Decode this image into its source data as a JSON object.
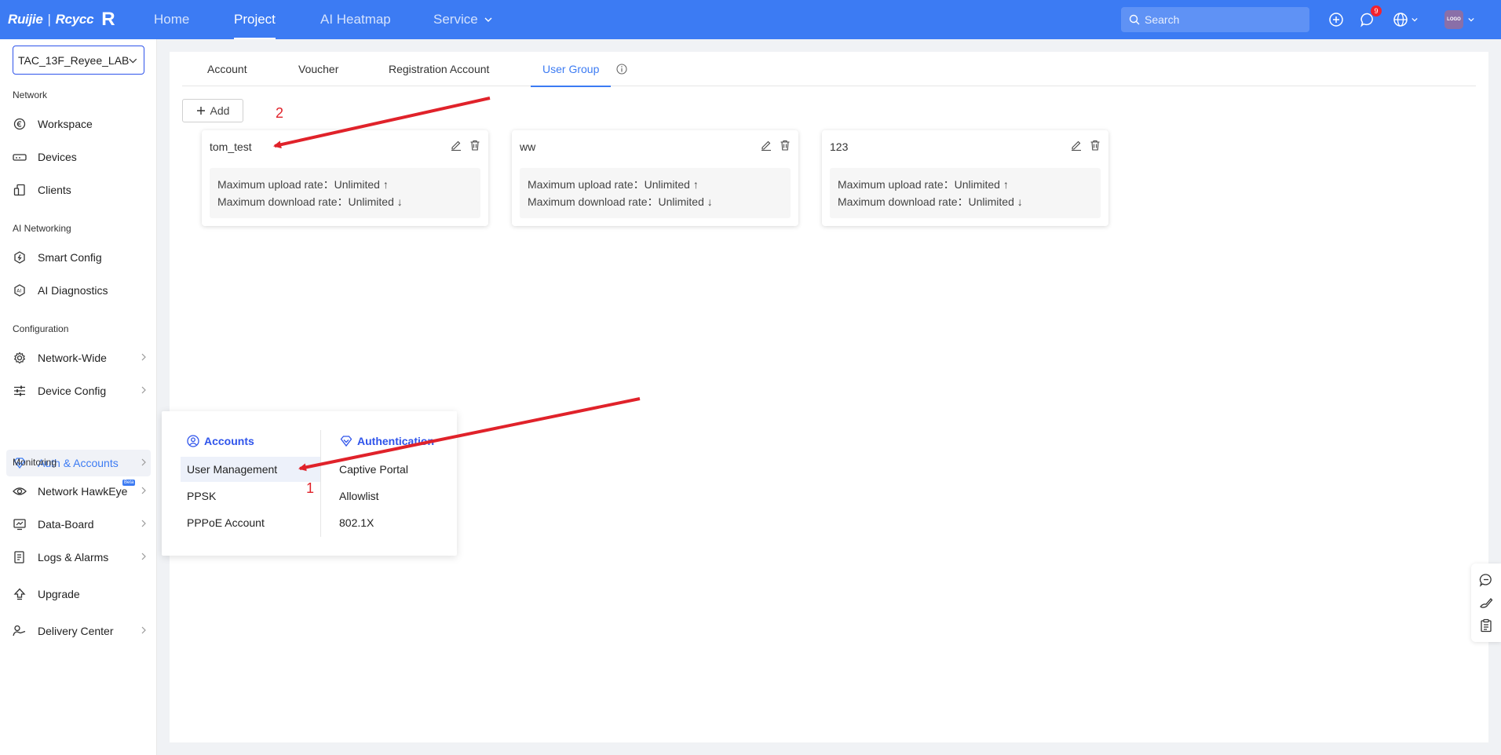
{
  "topbar": {
    "logo_brand": "Ruijie",
    "logo_sep": "|",
    "logo_sub": "Rcycc",
    "nav": [
      {
        "label": "Home"
      },
      {
        "label": "Project"
      },
      {
        "label": "AI Heatmap"
      },
      {
        "label": "Service"
      }
    ],
    "search_placeholder": "Search",
    "notification_count": "9",
    "avatar_text": "LOGO"
  },
  "sidebar": {
    "site": "TAC_13F_Reyee_LAB",
    "sections": {
      "network": "Network",
      "ai_networking": "AI Networking",
      "configuration": "Configuration",
      "monitoring": "Monitoring"
    },
    "items": {
      "workspace": "Workspace",
      "devices": "Devices",
      "clients": "Clients",
      "smart_config": "Smart Config",
      "ai_diagnostics": "AI Diagnostics",
      "network_wide": "Network-Wide",
      "device_config": "Device Config",
      "auth_accounts": "Auth & Accounts",
      "network_hawkeye": "Network HawkEye",
      "hawkeye_badge": "Beta",
      "data_board": "Data-Board",
      "logs_alarms": "Logs & Alarms",
      "upgrade": "Upgrade",
      "delivery_center": "Delivery Center"
    }
  },
  "main": {
    "tabs": [
      {
        "label": "Account"
      },
      {
        "label": "Voucher"
      },
      {
        "label": "Registration Account"
      },
      {
        "label": "User Group"
      }
    ],
    "add_label": "Add",
    "groups": [
      {
        "name": "tom_test",
        "upload": "Maximum upload rate：Unlimited",
        "download": "Maximum download rate：Unlimited"
      },
      {
        "name": "ww",
        "upload": "Maximum upload rate：Unlimited",
        "download": "Maximum download rate：Unlimited"
      },
      {
        "name": "123",
        "upload": "Maximum upload rate：Unlimited",
        "download": "Maximum download rate：Unlimited"
      }
    ]
  },
  "popup": {
    "accounts_title": "Accounts",
    "accounts_items": [
      "User Management",
      "PPSK",
      "PPPoE Account"
    ],
    "auth_title": "Authentication",
    "auth_items": [
      "Captive Portal",
      "Allowlist",
      "802.1X"
    ]
  },
  "annotations": {
    "step1": "1",
    "step2": "2",
    "arrow_color": "#e0222a"
  },
  "colors": {
    "brand": "#3c7bf3",
    "accent": "#2f54eb"
  }
}
